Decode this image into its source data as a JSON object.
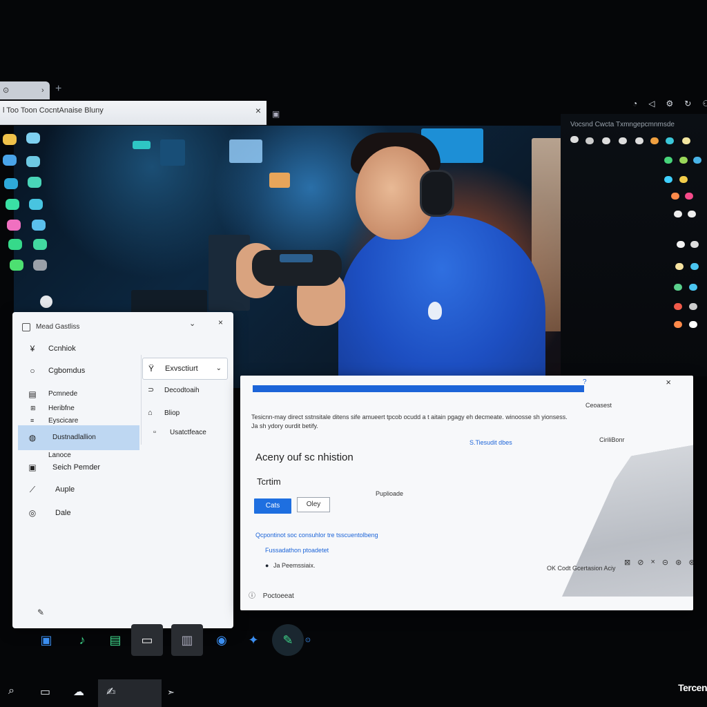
{
  "browser": {
    "tab_label": "⊙",
    "tab_close": "›",
    "new_tab": "+",
    "window_title": "l Too Toon CocntAnaise Bluny",
    "close": "×"
  },
  "right_panel": {
    "title": "Vocsnd Cwcta Txmngepcmnmsde"
  },
  "settings": {
    "title": "Mead Gastliss",
    "nav": [
      {
        "label": "Ccnhiok",
        "icon": "¥"
      },
      {
        "label": "Cgbomdus",
        "icon": "○"
      },
      {
        "label": "Pcmnede",
        "icon": "▤"
      },
      {
        "label": "Heribfne",
        "icon": "⊞"
      },
      {
        "label": "Eyscicare",
        "icon": "≡"
      },
      {
        "label": "Dustnadlallion",
        "icon": "◍"
      },
      {
        "label": "Lanoce",
        "icon": ""
      },
      {
        "label": "Seich Pemder",
        "icon": "▣"
      },
      {
        "label": "Auple",
        "icon": "⟋"
      },
      {
        "label": "Dale",
        "icon": "◎"
      }
    ],
    "dropdown": {
      "label": "Exvsctiurt",
      "icon": "Ÿ",
      "chevron": "⌄"
    },
    "section_items": [
      {
        "label": "Decodtoaih",
        "icon": "⊃"
      },
      {
        "label": "Bliop",
        "icon": "⌂"
      },
      {
        "label": "Usatctfeace",
        "icon": "▫"
      }
    ],
    "close": "×",
    "chevron": "⌄"
  },
  "dialog": {
    "description": "Tesicnn-may direct sstnsitale ditens sife amueert tpcob ocudd a t aitain pgagy eh decmeate. winoosse sh yionsess. Ja sh ydory ourdit betify.",
    "link1": "S.Tiesudit dbes",
    "right_top": "Ceoasest",
    "right_mid": "CiriliBonr",
    "heading": "Aceny ouf sc nhistion",
    "label": "Tcrtim",
    "field": "Puplioade",
    "ok_label": "Cats",
    "cancel_label": "Oley",
    "bullets": [
      "Qcpontinot soc consuhlor tre tsscuentolbeng",
      "Fussadathon ptoadetet",
      "Ja Peemssiaix."
    ],
    "bottom_text": "OK Codt Gcertasion Aciy",
    "tools": [
      "⊠",
      "⊘",
      "×",
      "⊝",
      "⊛",
      "⊗"
    ],
    "footer": "Poctoeeat",
    "help": "?",
    "close": "×"
  },
  "colors": {
    "accent": "#1c64d8",
    "hoodie": "#1d4fc2",
    "active_nav": "#bed7f2"
  },
  "taskbar": {
    "brand": "Tercen"
  }
}
